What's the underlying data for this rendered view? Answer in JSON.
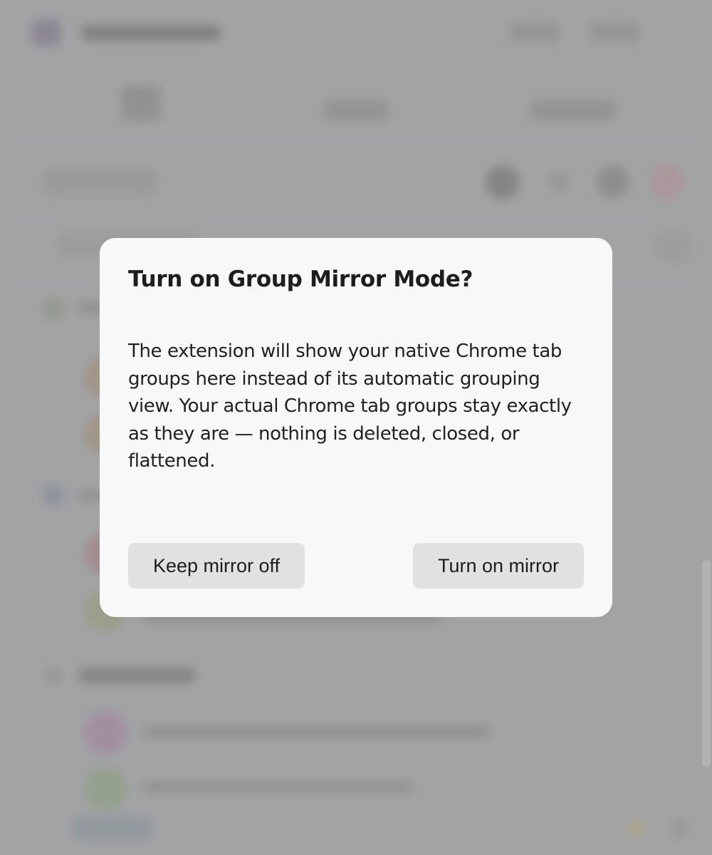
{
  "dialog": {
    "title": "Turn on Group Mirror Mode?",
    "body": "The extension will show your native Chrome tab groups here instead of its automatic grouping view. Your actual Chrome tab groups stay exactly as they are — nothing is deleted, closed, or flattened.",
    "secondary_button_label": "Keep mirror off",
    "primary_button_label": "Turn on mirror"
  },
  "colors": {
    "overlay": "#a2a3a5",
    "dialog_background": "#f6f8fa",
    "button_background": "#e0e1e3",
    "text": "#1c1d1f"
  }
}
